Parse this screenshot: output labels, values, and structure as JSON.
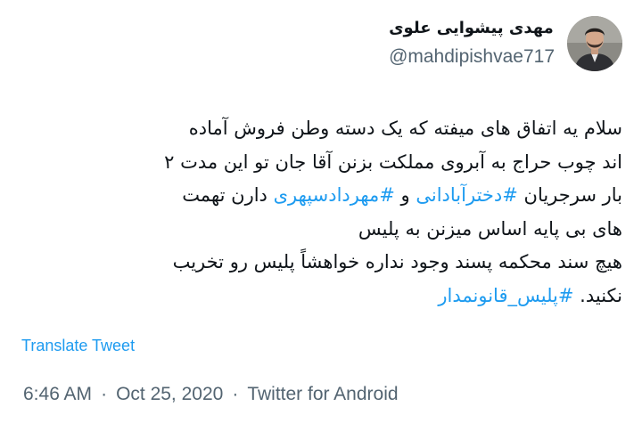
{
  "user": {
    "display_name": "مهدی پیشوایی علوی",
    "handle": "@mahdipishvae717"
  },
  "tweet": {
    "line1": "سلام  یه اتفاق های میفته که یک دسته وطن فروش آماده",
    "line2": "اند چوب حراج به آبروی مملکت بزنن آقا جان تو این مدت ۲",
    "line3_a": "بار سرجریان ",
    "hashtag1": "#دخترآبادانی",
    "line3_b": " و ",
    "hashtag2": "#مهردادسپهری",
    "line3_c": " دارن تهمت",
    "line4": "های بی پایه اساس میزنن به پلیس",
    "line5": "هیچ سند محکمه پسند وجود نداره خواهشاً پلیس رو تخریب",
    "line6_a": "نکنید. ",
    "hashtag3": "#پلیس_قانونمدار"
  },
  "translate_label": "Translate Tweet",
  "meta": {
    "time": "6:46 AM",
    "sep": "·",
    "date": "Oct 25, 2020",
    "source": "Twitter for Android"
  },
  "icons": {
    "more": "more-options-icon",
    "avatar": "profile-photo"
  },
  "colors": {
    "link": "#1d9bf0",
    "text": "#0f1419",
    "secondary": "#536471"
  }
}
